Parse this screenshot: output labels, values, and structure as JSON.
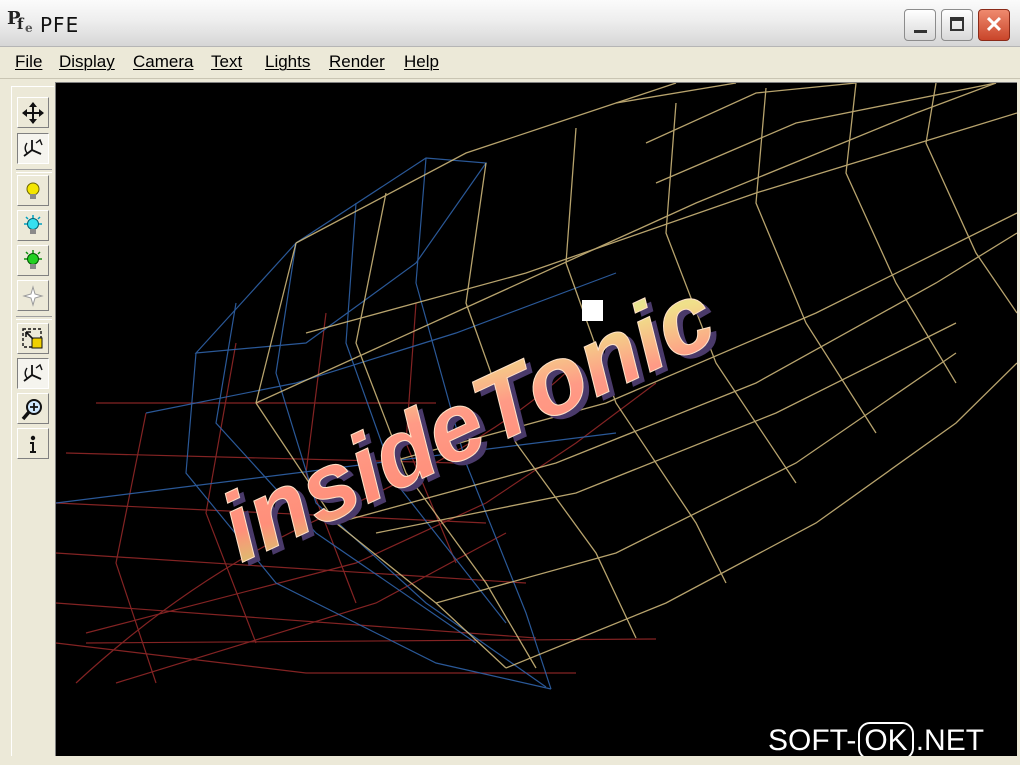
{
  "window": {
    "title": "PFE",
    "icon": "pfe-app-icon"
  },
  "menu": [
    {
      "label": "File"
    },
    {
      "label": "Display"
    },
    {
      "label": "Camera"
    },
    {
      "label": "Text"
    },
    {
      "label": "Lights"
    },
    {
      "label": "Render"
    },
    {
      "label": "Help"
    }
  ],
  "toolbar": [
    {
      "icon": "move-arrows-icon",
      "pressed": false
    },
    {
      "icon": "rotate-axes-icon",
      "pressed": true
    },
    {
      "icon": "light-yellow-icon",
      "pressed": false
    },
    {
      "icon": "light-cyan-icon",
      "pressed": false
    },
    {
      "icon": "light-green-icon",
      "pressed": false
    },
    {
      "icon": "light-white-icon",
      "pressed": false
    },
    {
      "icon": "select-region-icon",
      "pressed": false
    },
    {
      "icon": "rotate-axes-icon",
      "pressed": true
    },
    {
      "icon": "zoom-icon",
      "pressed": false
    },
    {
      "icon": "info-icon",
      "pressed": false
    }
  ],
  "scene": {
    "text3d": "insideTonic",
    "colors": {
      "background": "#000000",
      "wire_gold": "#d8c080",
      "wire_blue": "#3a6fb0",
      "wire_red": "#9a2a2a"
    }
  },
  "watermark": {
    "left": "SOFT-",
    "box": "OK",
    "right": ".NET"
  }
}
